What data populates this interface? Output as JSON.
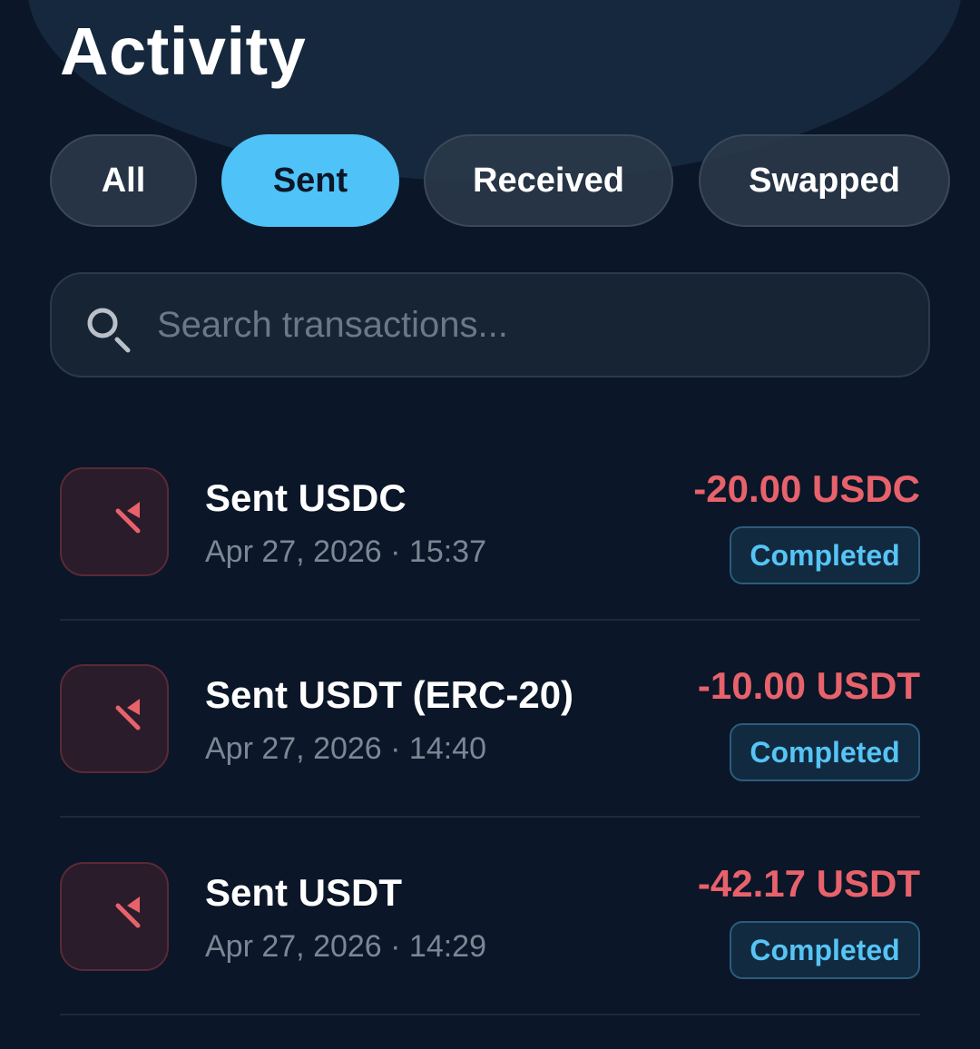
{
  "header": {
    "title": "Activity"
  },
  "tabs": [
    {
      "label": "All",
      "active": false
    },
    {
      "label": "Sent",
      "active": true
    },
    {
      "label": "Received",
      "active": false
    },
    {
      "label": "Swapped",
      "active": false
    }
  ],
  "search": {
    "placeholder": "Search transactions..."
  },
  "transactions": [
    {
      "title": "Sent USDC",
      "timestamp": "Apr 27, 2026 · 15:37",
      "amount": "-20.00 USDC",
      "status": "Completed",
      "icon": "sent-arrow-icon"
    },
    {
      "title": "Sent USDT (ERC-20)",
      "timestamp": "Apr 27, 2026 · 14:40",
      "amount": "-10.00 USDT",
      "status": "Completed",
      "icon": "sent-arrow-icon"
    },
    {
      "title": "Sent USDT",
      "timestamp": "Apr 27, 2026 · 14:29",
      "amount": "-42.17 USDT",
      "status": "Completed",
      "icon": "sent-arrow-icon"
    }
  ],
  "colors": {
    "background": "#0b1628",
    "accent": "#4fc3f7",
    "sent_amount": "#e8626b",
    "status_text": "#56c4f5"
  }
}
